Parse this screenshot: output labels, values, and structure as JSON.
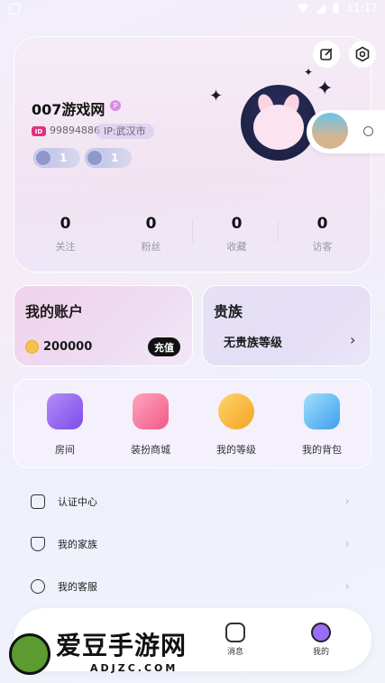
{
  "status_bar": {
    "time": "11:17"
  },
  "profile": {
    "username": "007游戏网",
    "id_tag": "ID",
    "id_number": "99894886",
    "ip_location": "IP:武汉市",
    "badges": [
      {
        "value": "1"
      },
      {
        "value": "1"
      }
    ],
    "stats": [
      {
        "value": "0",
        "label": "关注"
      },
      {
        "value": "0",
        "label": "粉丝"
      },
      {
        "value": "0",
        "label": "收藏"
      },
      {
        "value": "0",
        "label": "访客"
      }
    ]
  },
  "account": {
    "title": "我的账户",
    "coins": "200000",
    "recharge_label": "充值"
  },
  "noble": {
    "title": "贵族",
    "level": "无贵族等级"
  },
  "features": [
    {
      "label": "房间",
      "color": "#8e5cf0"
    },
    {
      "label": "装扮商城",
      "color": "#f06a8e"
    },
    {
      "label": "我的等级",
      "color": "#f6b52c"
    },
    {
      "label": "我的背包",
      "color": "#5fb4f5"
    }
  ],
  "menu": [
    {
      "label": "认证中心"
    },
    {
      "label": "我的家族"
    },
    {
      "label": "我的客服"
    }
  ],
  "tabs": [
    {
      "label": "消息"
    },
    {
      "label": "我的"
    }
  ],
  "watermark": {
    "title": "爱豆手游网",
    "subtitle": "ADJZC.COM"
  }
}
